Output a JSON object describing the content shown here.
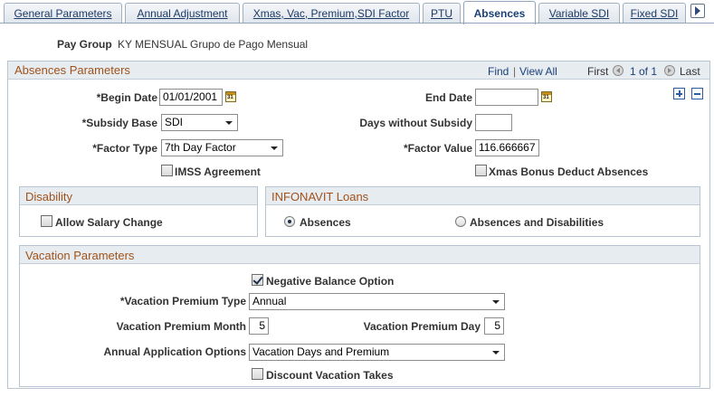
{
  "tabs": [
    {
      "label": "General Parameters",
      "active": false
    },
    {
      "label": "Annual Adjustment",
      "active": false
    },
    {
      "label": "Xmas, Vac, Premium,SDI Factor",
      "active": false
    },
    {
      "label": "PTU",
      "active": false
    },
    {
      "label": "Absences",
      "active": true
    },
    {
      "label": "Variable SDI",
      "active": false
    },
    {
      "label": "Fixed SDI",
      "active": false
    }
  ],
  "tab_more_icon": "arrow-right-icon",
  "pay_group": {
    "label": "Pay Group",
    "code": "KY MENSUAL",
    "description": "Grupo de Pago Mensual"
  },
  "absences_parameters": {
    "title": "Absences Parameters",
    "nav": {
      "find": "Find",
      "separator": "|",
      "view_all": "View All",
      "first": "First",
      "position": "1 of 1",
      "last": "Last"
    },
    "begin_date": {
      "label": "*Begin Date",
      "value": "01/01/2001"
    },
    "end_date": {
      "label": "End Date",
      "value": ""
    },
    "calendar_icon_text": "31",
    "subsidy_base": {
      "label": "*Subsidy Base",
      "value": "SDI"
    },
    "days_without_subsidy": {
      "label": "Days without Subsidy",
      "value": ""
    },
    "factor_type": {
      "label": "*Factor Type",
      "value": "7th Day Factor"
    },
    "factor_value": {
      "label": "*Factor Value",
      "value": "116.666667"
    },
    "imss_agreement": {
      "label": "IMSS Agreement",
      "checked": false
    },
    "xmas_bonus": {
      "label": "Xmas Bonus Deduct Absences",
      "checked": false
    }
  },
  "disability": {
    "title": "Disability",
    "allow_salary_change": {
      "label": "Allow Salary Change",
      "checked": false
    }
  },
  "infonavit": {
    "title": "INFONAVIT Loans",
    "options": [
      {
        "label": "Absences",
        "selected": true
      },
      {
        "label": "Absences and Disabilities",
        "selected": false
      }
    ]
  },
  "vacation": {
    "title": "Vacation Parameters",
    "negative_balance": {
      "label": "Negative Balance Option",
      "checked": true
    },
    "premium_type": {
      "label": "*Vacation Premium Type",
      "value": "Annual"
    },
    "premium_month": {
      "label": "Vacation Premium Month",
      "value": "5"
    },
    "premium_day": {
      "label": "Vacation Premium Day",
      "value": "5"
    },
    "annual_application": {
      "label": "Annual Application Options",
      "value": "Vacation Days and Premium"
    },
    "discount_vacation": {
      "label": "Discount Vacation Takes",
      "checked": false
    }
  },
  "colors": {
    "section_title": "#a0521a",
    "link": "#1a3f78",
    "header_bg": "#e7ecf1"
  }
}
